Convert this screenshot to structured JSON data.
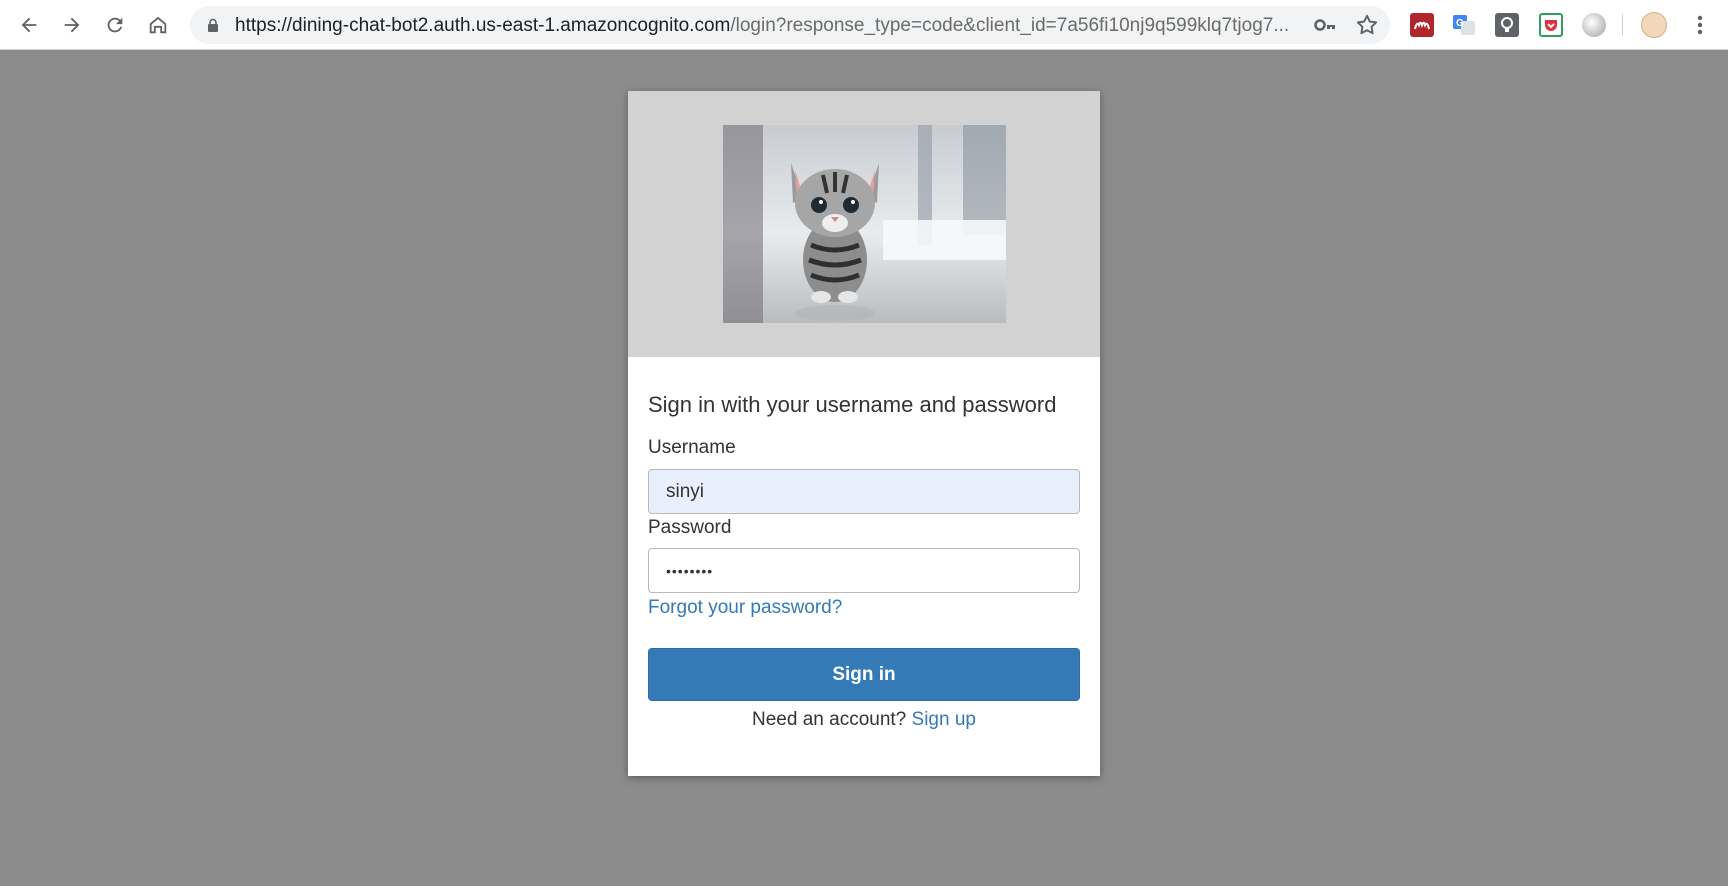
{
  "browser": {
    "url_host": "https://dining-chat-bot2.auth.us-east-1.amazoncognito.com",
    "url_rest": "/login?response_type=code&client_id=7a56fi10nj9q599klq7tjog7..."
  },
  "login": {
    "heading": "Sign in with your username and password",
    "username_label": "Username",
    "username_value": "sinyi",
    "password_label": "Password",
    "password_value": "••••••••",
    "forgot_link": "Forgot your password?",
    "signin_button": "Sign in",
    "need_account": "Need an account?",
    "signup_link": "Sign up"
  },
  "colors": {
    "page_background": "#8c8c8c",
    "link": "#337ab7",
    "button": "#337ab7",
    "banner": "#d2d2d2"
  }
}
